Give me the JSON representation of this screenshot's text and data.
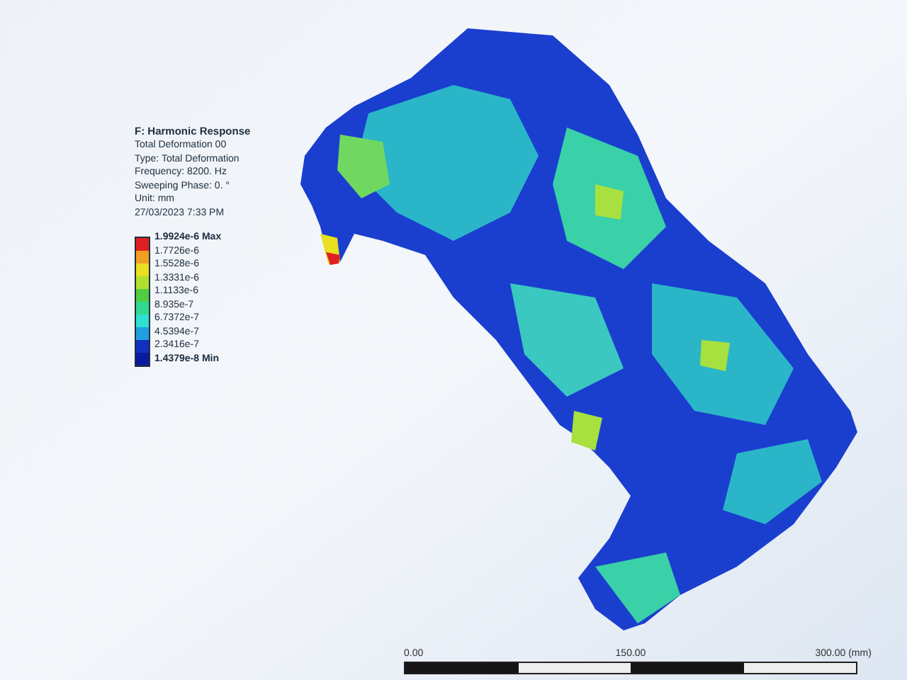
{
  "legend": {
    "title": "F: Harmonic Response",
    "details": [
      "Total Deformation 00",
      "Type: Total Deformation",
      "Frequency: 8200. Hz",
      "Sweeping Phase: 0. °",
      "Unit: mm",
      "27/03/2023 7:33 PM"
    ],
    "bands": [
      {
        "color": "#e02020"
      },
      {
        "color": "#f0a020"
      },
      {
        "color": "#e8e020"
      },
      {
        "color": "#b0e030"
      },
      {
        "color": "#50d040"
      },
      {
        "color": "#30d890"
      },
      {
        "color": "#30e0d0"
      },
      {
        "color": "#20a0e0"
      },
      {
        "color": "#1030c0"
      },
      {
        "color": "#0a1aa0"
      }
    ],
    "labels": [
      {
        "kind": "max",
        "text": "1.9924e-6 Max"
      },
      {
        "kind": "value",
        "text": "1.7726e-6"
      },
      {
        "kind": "value",
        "text": "1.5528e-6"
      },
      {
        "kind": "value",
        "text": "1.3331e-6"
      },
      {
        "kind": "value",
        "text": "1.1133e-6"
      },
      {
        "kind": "value",
        "text": "8.935e-7"
      },
      {
        "kind": "value",
        "text": "6.7372e-7"
      },
      {
        "kind": "value",
        "text": "4.5394e-7"
      },
      {
        "kind": "value",
        "text": "2.3416e-7"
      },
      {
        "kind": "min",
        "text": "1.4379e-8 Min"
      }
    ]
  },
  "scale_bar": {
    "ticks": [
      "0.00",
      "150.00",
      "300.00 (mm)"
    ]
  }
}
